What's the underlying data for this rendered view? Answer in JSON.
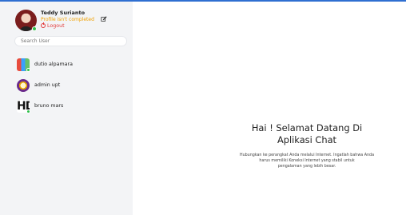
{
  "profile": {
    "name": "Teddy Surianto",
    "status": "Profile isn't completed",
    "logout_label": "Logout"
  },
  "search": {
    "placeholder": "Search User"
  },
  "users": [
    {
      "name": "dutio alpamara",
      "avatar": "colorful-avatar",
      "online": true
    },
    {
      "name": "admin upt",
      "avatar": "emblem-avatar",
      "online": false
    },
    {
      "name": "bruno mars",
      "avatar": "hd-logo-avatar",
      "online": true
    }
  ],
  "welcome": {
    "title_line1": "Hai ! Selamat Datang Di",
    "title_line2": "Aplikasi Chat",
    "subtitle_line1": "Hubungkan ke perangkat Anda melalui Internet. Ingatlah bahwa Anda",
    "subtitle_line2": "harus memiliki Koneksi Internet yang stabil untuk",
    "subtitle_line3": "pengalaman yang lebih besar."
  },
  "colors": {
    "accent": "#2f6fd1",
    "status_warning": "#f0a100",
    "logout": "#e23b3b",
    "online": "#2fbf4a",
    "sidebar_bg": "#f3f4f6"
  }
}
